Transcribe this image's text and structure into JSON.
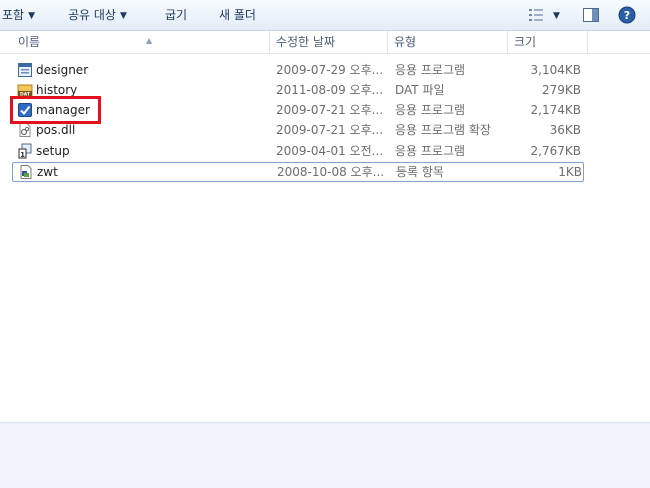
{
  "toolbar": {
    "include_label": "포함",
    "share_label": "공유 대상",
    "burn_label": "굽기",
    "new_folder_label": "새 폴더",
    "icons": [
      "view-options-icon",
      "preview-pane-icon",
      "help-icon"
    ]
  },
  "columns": {
    "name": "이름",
    "date": "수정한 날짜",
    "type": "유형",
    "size": "크기"
  },
  "files": [
    {
      "name": "designer",
      "date": "2009-07-29 오후...",
      "type": "응용 프로그램",
      "size": "3,104KB",
      "icon": "application-icon"
    },
    {
      "name": "history",
      "date": "2011-08-09 오후...",
      "type": "DAT 파일",
      "size": "279KB",
      "icon": "dat-file-icon"
    },
    {
      "name": "manager",
      "date": "2009-07-21 오후...",
      "type": "응용 프로그램",
      "size": "2,174KB",
      "icon": "checkbox-app-icon"
    },
    {
      "name": "pos.dll",
      "date": "2009-07-21 오후...",
      "type": "응용 프로그램 확장",
      "size": "36KB",
      "icon": "dll-file-icon"
    },
    {
      "name": "setup",
      "date": "2009-04-01 오전...",
      "type": "응용 프로그램",
      "size": "2,767KB",
      "icon": "setup-icon"
    },
    {
      "name": "zwt",
      "date": "2008-10-08 오후...",
      "type": "등록 항목",
      "size": "1KB",
      "icon": "registry-file-icon"
    }
  ],
  "colors": {
    "highlight": "#e0121b",
    "selection_border": "#7da2ce",
    "toolbar_text": "#1e395b"
  }
}
